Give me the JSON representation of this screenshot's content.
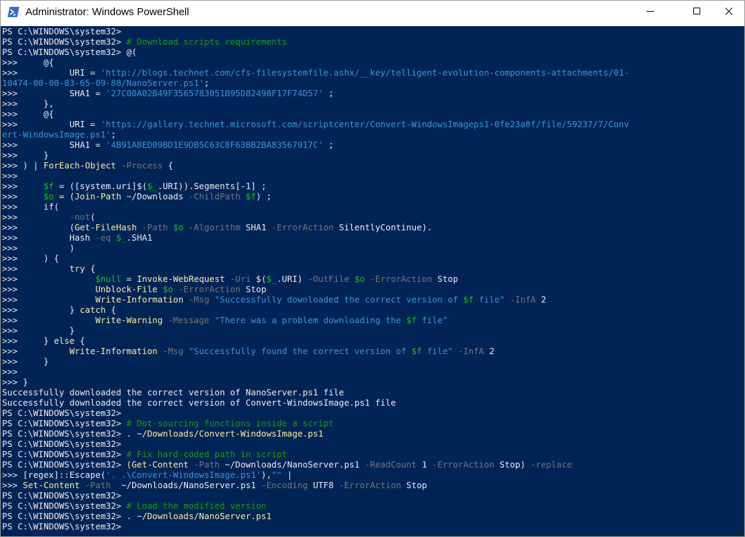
{
  "window": {
    "title": "Administrator: Windows PowerShell",
    "icon": "powershell-icon",
    "controls": {
      "minimize": "—",
      "maximize": "☐",
      "close": "✕"
    }
  },
  "colors": {
    "console_bg": "#012456",
    "default_text": "#eeedf0",
    "comment": "#13a10e",
    "command": "#f9f1a5",
    "string": "#3a96dd",
    "variable": "#16c60c",
    "parameter": "#767676"
  },
  "console": {
    "lines": [
      [
        [
          "w",
          "PS C:\\WINDOWS\\system32> "
        ]
      ],
      [
        [
          "w",
          "PS C:\\WINDOWS\\system32> "
        ],
        [
          "c",
          "# Download scripts requirements"
        ]
      ],
      [
        [
          "w",
          "PS C:\\WINDOWS\\system32> @("
        ]
      ],
      [
        [
          "w",
          ">>>     @{"
        ]
      ],
      [
        [
          "w",
          ">>>          URI = "
        ],
        [
          "s",
          "'http://blogs.technet.com/cfs-filesystemfile.ashx/__key/telligent-evolution-components-attachments/01-"
        ]
      ],
      [
        [
          "s",
          "10474-00-00-03-65-09-88/NanoServer.ps1'"
        ],
        [
          "w",
          ";"
        ]
      ],
      [
        [
          "w",
          ">>>          SHA1 = "
        ],
        [
          "s",
          "'27C00A02B49F3565783051B95D82498F17F74D57'"
        ],
        [
          "w",
          " ;"
        ]
      ],
      [
        [
          "w",
          ">>>     },"
        ]
      ],
      [
        [
          "w",
          ">>>     @{"
        ]
      ],
      [
        [
          "w",
          ">>>          URI = "
        ],
        [
          "s",
          "'https://gallery.technet.microsoft.com/scriptcenter/Convert-WindowsImageps1-0fe23a8f/file/59237/7/Conv"
        ]
      ],
      [
        [
          "s",
          "ert-WindowsImage.ps1'"
        ],
        [
          "w",
          ";"
        ]
      ],
      [
        [
          "w",
          ">>>          SHA1 = "
        ],
        [
          "s",
          "'4B91A8ED09BD1E9DB5C63C8F63BB2BA83567917C'"
        ],
        [
          "w",
          " ;"
        ]
      ],
      [
        [
          "w",
          ">>>     }"
        ]
      ],
      [
        [
          "w",
          ">>> ) | "
        ],
        [
          "k",
          "ForEach-Object"
        ],
        [
          "w",
          " "
        ],
        [
          "p",
          "-Process"
        ],
        [
          "w",
          " {"
        ]
      ],
      [
        [
          "w",
          ">>>"
        ]
      ],
      [
        [
          "w",
          ">>>     "
        ],
        [
          "v",
          "$f"
        ],
        [
          "w",
          " = ([system.uri]$("
        ],
        [
          "v",
          "$_"
        ],
        [
          "w",
          ".URI)).Segments[-1] ;"
        ]
      ],
      [
        [
          "w",
          ">>>     "
        ],
        [
          "v",
          "$o"
        ],
        [
          "w",
          " = ("
        ],
        [
          "k",
          "Join-Path"
        ],
        [
          "w",
          " ~/Downloads "
        ],
        [
          "p",
          "-ChildPath"
        ],
        [
          "w",
          " "
        ],
        [
          "v",
          "$f"
        ],
        [
          "w",
          ") ;"
        ]
      ],
      [
        [
          "w",
          ">>>     if("
        ]
      ],
      [
        [
          "w",
          ">>>          "
        ],
        [
          "p",
          "-not"
        ],
        [
          "w",
          "("
        ]
      ],
      [
        [
          "w",
          ">>>          ("
        ],
        [
          "k",
          "Get-FileHash"
        ],
        [
          "w",
          " "
        ],
        [
          "p",
          "-Path"
        ],
        [
          "w",
          " "
        ],
        [
          "v",
          "$o"
        ],
        [
          "w",
          " "
        ],
        [
          "p",
          "-Algorithm"
        ],
        [
          "w",
          " SHA1 "
        ],
        [
          "p",
          "-ErrorAction"
        ],
        [
          "w",
          " SilentlyContinue)."
        ]
      ],
      [
        [
          "w",
          ">>>          Hash "
        ],
        [
          "p",
          "-eq"
        ],
        [
          "w",
          " "
        ],
        [
          "v",
          "$_"
        ],
        [
          "w",
          ".SHA1"
        ]
      ],
      [
        [
          "w",
          ">>>          )"
        ]
      ],
      [
        [
          "w",
          ">>>     ) {"
        ]
      ],
      [
        [
          "w",
          ">>>          "
        ],
        [
          "k",
          "try"
        ],
        [
          "w",
          " {"
        ]
      ],
      [
        [
          "w",
          ">>>               "
        ],
        [
          "v",
          "$null"
        ],
        [
          "w",
          " = "
        ],
        [
          "k",
          "Invoke-WebRequest"
        ],
        [
          "w",
          " "
        ],
        [
          "p",
          "-Uri"
        ],
        [
          "w",
          " $("
        ],
        [
          "v",
          "$_"
        ],
        [
          "w",
          ".URI) "
        ],
        [
          "p",
          "-OutFile"
        ],
        [
          "w",
          " "
        ],
        [
          "v",
          "$o"
        ],
        [
          "w",
          " "
        ],
        [
          "p",
          "-ErrorAction"
        ],
        [
          "w",
          " Stop"
        ]
      ],
      [
        [
          "w",
          ">>>               "
        ],
        [
          "k",
          "Unblock-File"
        ],
        [
          "w",
          " "
        ],
        [
          "v",
          "$o"
        ],
        [
          "w",
          " "
        ],
        [
          "p",
          "-ErrorAction"
        ],
        [
          "w",
          " Stop"
        ]
      ],
      [
        [
          "w",
          ">>>               "
        ],
        [
          "k",
          "Write-Information"
        ],
        [
          "w",
          " "
        ],
        [
          "p",
          "-Msg"
        ],
        [
          "w",
          " "
        ],
        [
          "s",
          "\"Successfully downloaded the correct version of "
        ],
        [
          "v",
          "$f"
        ],
        [
          "s",
          " file\""
        ],
        [
          "w",
          " "
        ],
        [
          "p",
          "-InfA"
        ],
        [
          "w",
          " 2"
        ]
      ],
      [
        [
          "w",
          ">>>          } "
        ],
        [
          "k",
          "catch"
        ],
        [
          "w",
          " {"
        ]
      ],
      [
        [
          "w",
          ">>>               "
        ],
        [
          "k",
          "Write-Warning"
        ],
        [
          "w",
          " "
        ],
        [
          "p",
          "-Message"
        ],
        [
          "w",
          " "
        ],
        [
          "s",
          "\"There was a problem downloading the "
        ],
        [
          "v",
          "$f"
        ],
        [
          "s",
          " file\""
        ]
      ],
      [
        [
          "w",
          ">>>          }"
        ]
      ],
      [
        [
          "w",
          ">>>     } "
        ],
        [
          "k",
          "else"
        ],
        [
          "w",
          " {"
        ]
      ],
      [
        [
          "w",
          ">>>          "
        ],
        [
          "k",
          "Write-Information"
        ],
        [
          "w",
          " "
        ],
        [
          "p",
          "-Msg"
        ],
        [
          "w",
          " "
        ],
        [
          "s",
          "\"Successfully found the correct version of "
        ],
        [
          "v",
          "$f"
        ],
        [
          "s",
          " file\""
        ],
        [
          "w",
          " "
        ],
        [
          "p",
          "-InfA"
        ],
        [
          "w",
          " 2"
        ]
      ],
      [
        [
          "w",
          ">>>     }"
        ]
      ],
      [
        [
          "w",
          ">>>"
        ]
      ],
      [
        [
          "w",
          ">>> }"
        ]
      ],
      [
        [
          "w",
          "Successfully downloaded the correct version of NanoServer.ps1 file"
        ]
      ],
      [
        [
          "w",
          "Successfully downloaded the correct version of Convert-WindowsImage.ps1 file"
        ]
      ],
      [
        [
          "w",
          "PS C:\\WINDOWS\\system32> "
        ]
      ],
      [
        [
          "w",
          "PS C:\\WINDOWS\\system32> "
        ],
        [
          "c",
          "# Dot-sourcing functions inside a script"
        ]
      ],
      [
        [
          "w",
          "PS C:\\WINDOWS\\system32> "
        ],
        [
          "w",
          ". "
        ],
        [
          "y",
          "~/Downloads/Convert-WindowsImage.ps1"
        ]
      ],
      [
        [
          "w",
          "PS C:\\WINDOWS\\system32> "
        ]
      ],
      [
        [
          "w",
          "PS C:\\WINDOWS\\system32> "
        ],
        [
          "c",
          "# Fix hard-coded path in script"
        ]
      ],
      [
        [
          "w",
          "PS C:\\WINDOWS\\system32> "
        ],
        [
          "y",
          "(Get-Content"
        ],
        [
          "w",
          " "
        ],
        [
          "p",
          "-Path"
        ],
        [
          "w",
          " ~/Downloads/NanoServer.ps1 "
        ],
        [
          "p",
          "-ReadCount"
        ],
        [
          "w",
          " 1 "
        ],
        [
          "p",
          "-ErrorAction"
        ],
        [
          "w",
          " Stop) "
        ],
        [
          "p",
          "-replace"
        ]
      ],
      [
        [
          "w",
          ">>> [regex]::Escape("
        ],
        [
          "s",
          "'. .\\Convert-WindowsImage.ps1'"
        ],
        [
          "w",
          "),"
        ],
        [
          "s",
          "\"\""
        ],
        [
          "w",
          " |"
        ]
      ],
      [
        [
          "w",
          ">>> "
        ],
        [
          "k",
          "Set-Content"
        ],
        [
          "w",
          " "
        ],
        [
          "p",
          "-Path"
        ],
        [
          "w",
          "  ~/Downloads/NanoServer.ps1 "
        ],
        [
          "p",
          "-Encoding"
        ],
        [
          "w",
          " UTF8 "
        ],
        [
          "p",
          "-ErrorAction"
        ],
        [
          "w",
          " Stop"
        ]
      ],
      [
        [
          "w",
          "PS C:\\WINDOWS\\system32> "
        ]
      ],
      [
        [
          "w",
          "PS C:\\WINDOWS\\system32> "
        ],
        [
          "c",
          "# Load the modified version"
        ]
      ],
      [
        [
          "w",
          "PS C:\\WINDOWS\\system32> "
        ],
        [
          "w",
          ". "
        ],
        [
          "y",
          "~/Downloads/NanoServer.ps1"
        ]
      ],
      [
        [
          "w",
          "PS C:\\WINDOWS\\system32> "
        ]
      ]
    ]
  }
}
